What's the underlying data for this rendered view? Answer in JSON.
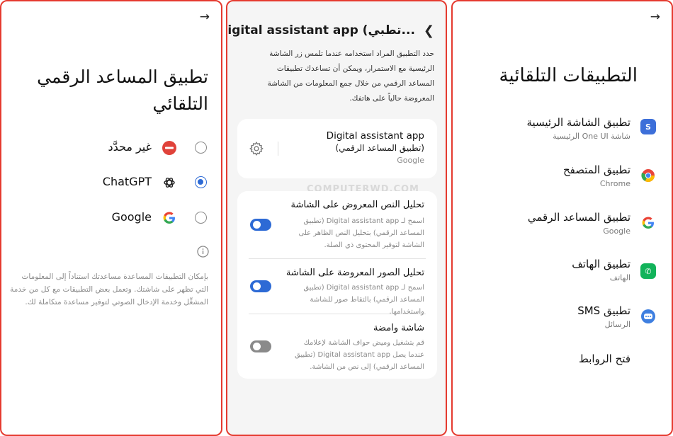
{
  "right_panel": {
    "back_icon": "arrow-right-icon",
    "title": "التطبيقات التلقائية",
    "items": [
      {
        "title": "تطبيق الشاشة الرئيسية",
        "subtitle": "شاشة One UI الرئيسية",
        "icon": "home-app-icon",
        "color": "#3d6fd9"
      },
      {
        "title": "تطبيق المتصفح",
        "subtitle": "Chrome",
        "icon": "chrome-icon",
        "color": "#e8453c"
      },
      {
        "title": "تطبيق المساعد الرقمي",
        "subtitle": "Google",
        "icon": "google-icon",
        "color": "#4285f4"
      },
      {
        "title": "تطبيق الهاتف",
        "subtitle": "الهاتف",
        "icon": "phone-icon",
        "color": "#12b35a"
      },
      {
        "title": "تطبيق SMS",
        "subtitle": "الرسائل",
        "icon": "messages-icon",
        "color": "#3e7fe0"
      },
      {
        "title": "فتح الروابط",
        "subtitle": "",
        "icon": "",
        "color": ""
      }
    ]
  },
  "middle_panel": {
    "header": "Digital assistant app (تطبي...",
    "description": "حدد التطبيق المراد استخدامه عندما تلمس زر الشاشة الرئيسية مع الاستمرار، ويمكن أن تساعدك تطبيقات المساعد الرقمي من خلال جمع المعلومات من الشاشة المعروضة حالياً على هاتفك.",
    "app_card": {
      "name": "Digital assistant app",
      "name_ar": "(تطبيق المساعد الرقمي)",
      "provider": "Google"
    },
    "toggles": [
      {
        "title": "تحليل النص المعروض على الشاشة",
        "desc": "اسمح لـ Digital assistant app (تطبيق المساعد الرقمي) بتحليل النص الظاهر على الشاشة لتوفير المحتوى ذي الصلة.",
        "state": "on"
      },
      {
        "title": "تحليل الصور المعروضة على الشاشة",
        "desc": "اسمح لـ Digital assistant app (تطبيق المساعد الرقمي) بالتقاط صور للشاشة واستخدامها.",
        "state": "on"
      },
      {
        "title": "شاشة وامضة",
        "desc": "قم بتشغيل وميض حواف الشاشة لإعلامك عندما يصل Digital assistant app (تطبيق المساعد الرقمي) إلى نص من الشاشة.",
        "state": "disabled"
      }
    ],
    "watermark": "COMPUTERWD.COM",
    "accent_color": "#2d6ad5"
  },
  "left_panel": {
    "back_icon": "arrow-right-icon",
    "title": "تطبيق المساعد الرقمي التلقائي",
    "options": [
      {
        "label": "غير محدَّد",
        "icon": "no-entry-icon",
        "selected": false
      },
      {
        "label": "ChatGPT",
        "icon": "chatgpt-icon",
        "selected": true
      },
      {
        "label": "Google",
        "icon": "google-icon",
        "selected": false
      }
    ],
    "info_icon": "info-icon",
    "description": "بإمكان التطبيقات المساعدة مساعدتك استناداً إلى المعلومات التي تظهر على شاشتك. وتعمل بعض التطبيقات مع كل من خدمة المشغِّل وخدمة الإدخال الصوتي لتوفير مساعدة متكاملة لك."
  }
}
